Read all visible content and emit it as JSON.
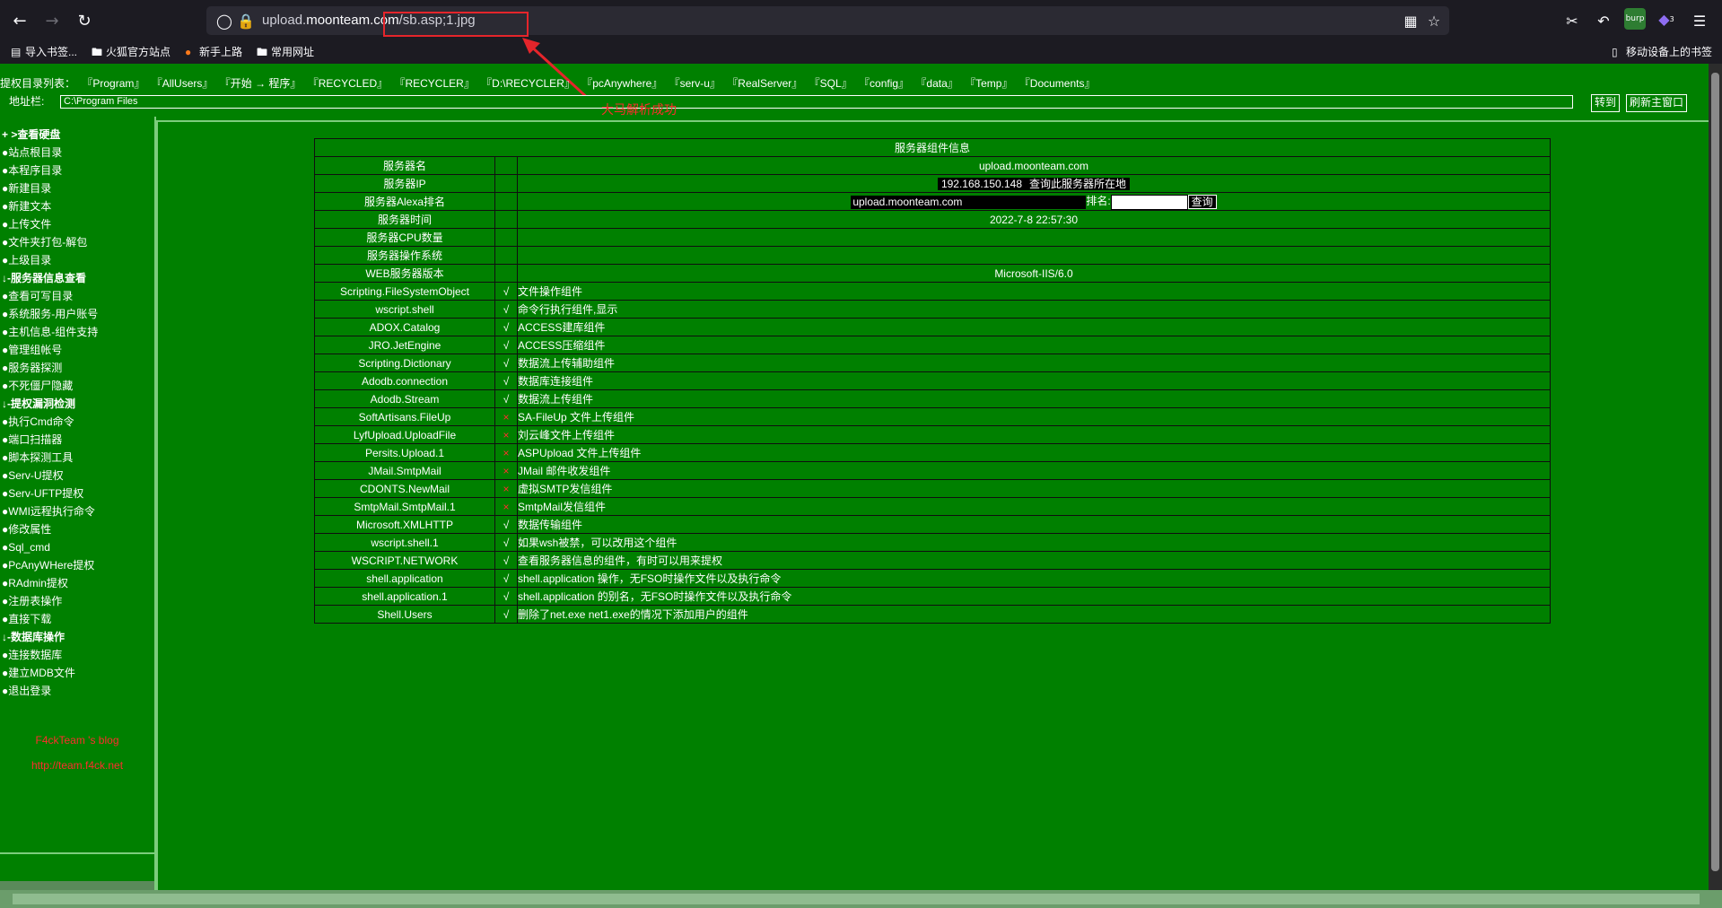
{
  "browser": {
    "url_domain_prefix": "upload.",
    "url_domain": "moonteam.com",
    "url_path": "/sb.asp;1.jpg",
    "bookmarks": [
      "导入书签...",
      "火狐官方站点",
      "新手上路",
      "常用网址"
    ],
    "mobile_bookmarks": "移动设备上的书签",
    "extension_badge": "3"
  },
  "annotation": {
    "text": "大马解析成功"
  },
  "topbar": {
    "label": "提权目录列表：",
    "links": [
      "『Program』",
      "『AllUsers』",
      "『开始 → 程序』",
      "『RECYCLED』",
      "『RECYCLER』",
      "『D:\\RECYCLER』",
      "『pcAnywhere』",
      "『serv-u』",
      "『RealServer』",
      "『SQL』",
      "『config』",
      "『data』",
      "『Temp』",
      "『Documents』"
    ]
  },
  "address": {
    "label": "地址栏:",
    "value": "C:\\Program Files",
    "go_button": "转到",
    "refresh_button": "刷新主窗口"
  },
  "sidebar": {
    "items": [
      {
        "text": "+ >查看硬盘",
        "head": true
      },
      {
        "text": "●站点根目录"
      },
      {
        "text": "●本程序目录"
      },
      {
        "text": "●新建目录"
      },
      {
        "text": "●新建文本"
      },
      {
        "text": "●上传文件"
      },
      {
        "text": "●文件夹打包-解包"
      },
      {
        "text": "●上级目录"
      },
      {
        "text": "↓-服务器信息查看",
        "head": true
      },
      {
        "text": "●查看可写目录"
      },
      {
        "text": "●系统服务-用户账号"
      },
      {
        "text": "●主机信息-组件支持"
      },
      {
        "text": "●管理组帐号"
      },
      {
        "text": "●服务器探测"
      },
      {
        "text": "●不死僵尸隐藏"
      },
      {
        "text": "↓-提权漏洞检测",
        "head": true
      },
      {
        "text": "●执行Cmd命令"
      },
      {
        "text": "●端口扫描器"
      },
      {
        "text": "●脚本探测工具"
      },
      {
        "text": "●Serv-U提权"
      },
      {
        "text": "●Serv-UFTP提权"
      },
      {
        "text": "●WMI远程执行命令"
      },
      {
        "text": "●修改属性"
      },
      {
        "text": "●Sql_cmd"
      },
      {
        "text": "●PcAnyWHere提权"
      },
      {
        "text": "●RAdmin提权"
      },
      {
        "text": "●注册表操作"
      },
      {
        "text": "●直接下载"
      },
      {
        "text": "↓-数据库操作",
        "head": true
      },
      {
        "text": "●连接数据库"
      },
      {
        "text": "●建立MDB文件"
      },
      {
        "text": "●退出登录"
      }
    ],
    "blog_title": "F4ckTeam 's blog",
    "blog_url": "http://team.f4ck.net"
  },
  "server_info": {
    "title": "服务器组件信息",
    "rows": [
      {
        "label": "服务器名",
        "value": "upload.moonteam.com"
      },
      {
        "label": "服务器IP",
        "ip": "192.168.150.148",
        "ip_link": "查询此服务器所在地"
      },
      {
        "label": "服务器Alexa排名",
        "alexa_input": "upload.moonteam.com",
        "rank_label": "排名:",
        "query_button": "查询"
      },
      {
        "label": "服务器时间",
        "value": "2022-7-8 22:57:30"
      },
      {
        "label": "服务器CPU数量",
        "value": ""
      },
      {
        "label": "服务器操作系统",
        "value": ""
      },
      {
        "label": "WEB服务器版本",
        "value": "Microsoft-IIS/6.0"
      }
    ],
    "components": [
      {
        "name": "Scripting.FileSystemObject",
        "mark": "√",
        "ok": true,
        "desc": "文件操作组件"
      },
      {
        "name": "wscript.shell",
        "mark": "√",
        "ok": true,
        "desc": "命令行执行组件,显示"
      },
      {
        "name": "ADOX.Catalog",
        "mark": "√",
        "ok": true,
        "desc": "ACCESS建库组件"
      },
      {
        "name": "JRO.JetEngine",
        "mark": "√",
        "ok": true,
        "desc": "ACCESS压缩组件"
      },
      {
        "name": "Scripting.Dictionary",
        "mark": "√",
        "ok": true,
        "desc": "数据流上传辅助组件"
      },
      {
        "name": "Adodb.connection",
        "mark": "√",
        "ok": true,
        "desc": "数据库连接组件"
      },
      {
        "name": "Adodb.Stream",
        "mark": "√",
        "ok": true,
        "desc": "数据流上传组件"
      },
      {
        "name": "SoftArtisans.FileUp",
        "mark": "×",
        "ok": false,
        "desc": "SA-FileUp 文件上传组件"
      },
      {
        "name": "LyfUpload.UploadFile",
        "mark": "×",
        "ok": false,
        "desc": "刘云峰文件上传组件"
      },
      {
        "name": "Persits.Upload.1",
        "mark": "×",
        "ok": false,
        "desc": "ASPUpload 文件上传组件"
      },
      {
        "name": "JMail.SmtpMail",
        "mark": "×",
        "ok": false,
        "desc": "JMail 邮件收发组件"
      },
      {
        "name": "CDONTS.NewMail",
        "mark": "×",
        "ok": false,
        "desc": "虚拟SMTP发信组件"
      },
      {
        "name": "SmtpMail.SmtpMail.1",
        "mark": "×",
        "ok": false,
        "desc": "SmtpMail发信组件"
      },
      {
        "name": "Microsoft.XMLHTTP",
        "mark": "√",
        "ok": true,
        "desc": "数据传输组件"
      },
      {
        "name": "wscript.shell.1",
        "mark": "√",
        "ok": true,
        "desc": "如果wsh被禁，可以改用这个组件"
      },
      {
        "name": "WSCRIPT.NETWORK",
        "mark": "√",
        "ok": true,
        "desc": "查看服务器信息的组件，有时可以用来提权"
      },
      {
        "name": "shell.application",
        "mark": "√",
        "ok": true,
        "desc": "shell.application 操作，无FSO时操作文件以及执行命令"
      },
      {
        "name": "shell.application.1",
        "mark": "√",
        "ok": true,
        "desc": "shell.application 的别名，无FSO时操作文件以及执行命令"
      },
      {
        "name": "Shell.Users",
        "mark": "√",
        "ok": true,
        "desc": "删除了net.exe net1.exe的情况下添加用户的组件"
      }
    ]
  },
  "colors": {
    "page_bg": "#008000",
    "annotation_red": "#e5252b",
    "browser_bg": "#1c1b22"
  }
}
